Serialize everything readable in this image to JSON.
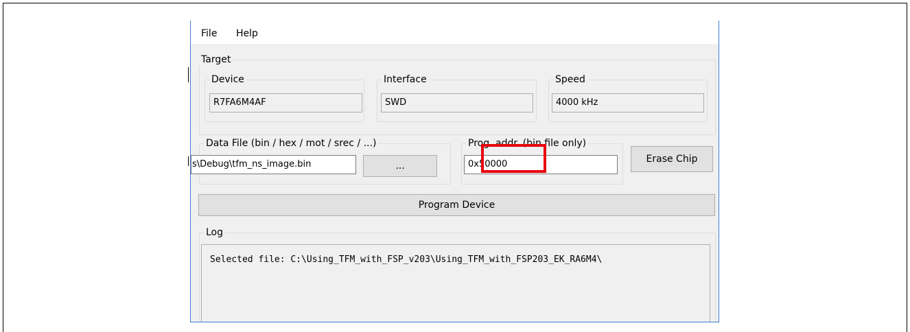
{
  "menu": {
    "file": "File",
    "help": "Help"
  },
  "target": {
    "legend": "Target",
    "device": {
      "legend": "Device",
      "value": "R7FA6M4AF"
    },
    "interface": {
      "legend": "Interface",
      "value": "SWD"
    },
    "speed": {
      "legend": "Speed",
      "value": "4000 kHz"
    }
  },
  "data_file": {
    "legend": "Data File (bin / hex / mot / srec / ...)",
    "path_value": "s\\Debug\\tfm_ns_image.bin",
    "browse_label": "..."
  },
  "prog_addr": {
    "legend": "Prog. addr. (bin file only)",
    "value": "0x50000"
  },
  "buttons": {
    "erase_chip": "Erase Chip",
    "program_device": "Program Device"
  },
  "log": {
    "legend": "Log",
    "text": "Selected file: C:\\Using_TFM_with_FSP_v203\\Using_TFM_with_FSP203_EK_RA6M4\\"
  },
  "colors": {
    "highlight": "#e8000b",
    "window_border": "#3c7fd6"
  }
}
